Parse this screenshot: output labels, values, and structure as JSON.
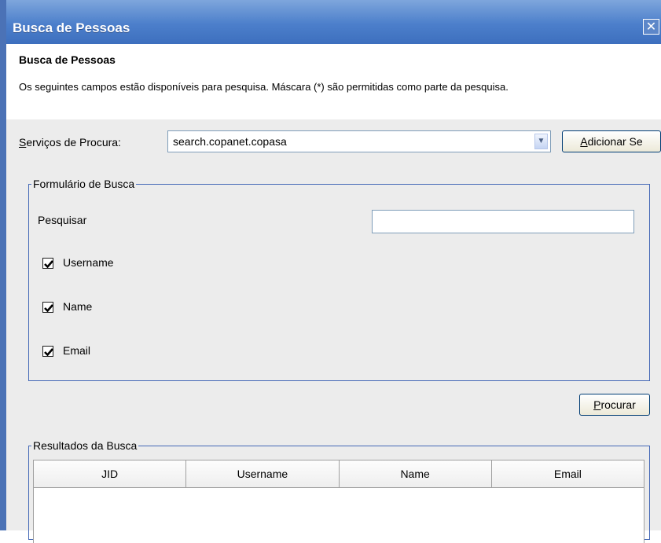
{
  "window": {
    "title": "Busca de Pessoas",
    "close_icon": "close-icon",
    "close_glyph": "✕"
  },
  "header": {
    "title": "Busca de Pessoas",
    "description": "Os seguintes campos estão disponíveis para pesquisa. Máscara (*) são permitidas como parte da pesquisa."
  },
  "service": {
    "label_mnemonic": "S",
    "label_rest": "erviços de Procura:",
    "selected_value": "search.copanet.copasa",
    "add_button_mnemonic": "A",
    "add_button_rest": "dicionar Se"
  },
  "form": {
    "legend": "Formulário de Busca",
    "search_label": "Pesquisar",
    "search_value": "",
    "checkboxes": [
      {
        "label": "Username",
        "checked": true
      },
      {
        "label": "Name",
        "checked": true
      },
      {
        "label": "Email",
        "checked": true
      }
    ],
    "search_button_mnemonic": "P",
    "search_button_rest": "rocurar"
  },
  "results": {
    "legend": "Resultados da Busca",
    "columns": [
      "JID",
      "Username",
      "Name",
      "Email"
    ],
    "rows": []
  },
  "colors": {
    "title_bar": "#4c7fcb",
    "group_border": "#4468b6",
    "panel_bg": "#ececec"
  }
}
